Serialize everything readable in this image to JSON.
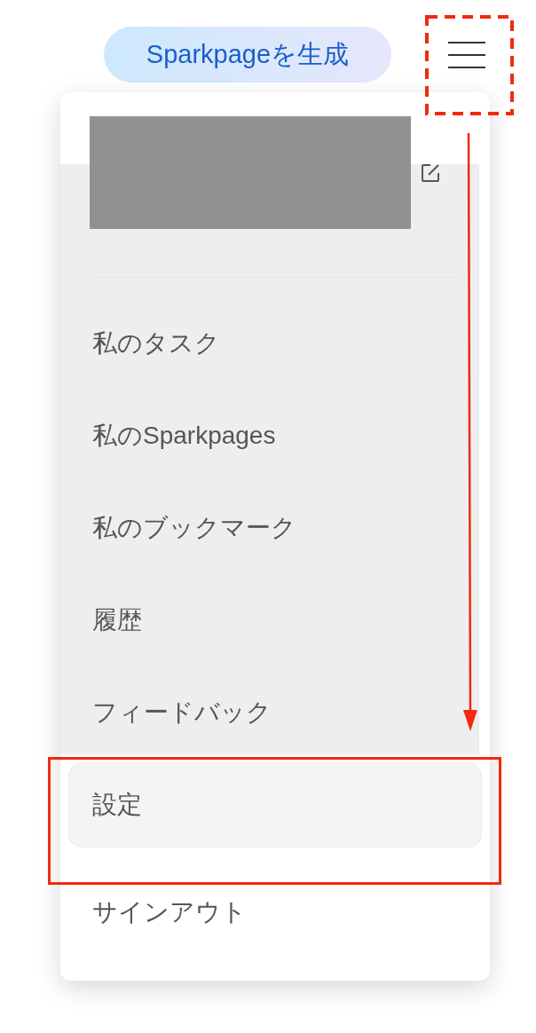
{
  "header": {
    "generate_button": "Sparkpageを生成"
  },
  "menu": {
    "items": [
      {
        "label": "私のタスク",
        "selected": false
      },
      {
        "label": "私のSparkpages",
        "selected": false
      },
      {
        "label": "私のブックマーク",
        "selected": false
      },
      {
        "label": "履歴",
        "selected": false
      },
      {
        "label": "フィードバック",
        "selected": false
      },
      {
        "label": "設定",
        "selected": true
      },
      {
        "label": "サインアウト",
        "selected": false
      }
    ]
  }
}
